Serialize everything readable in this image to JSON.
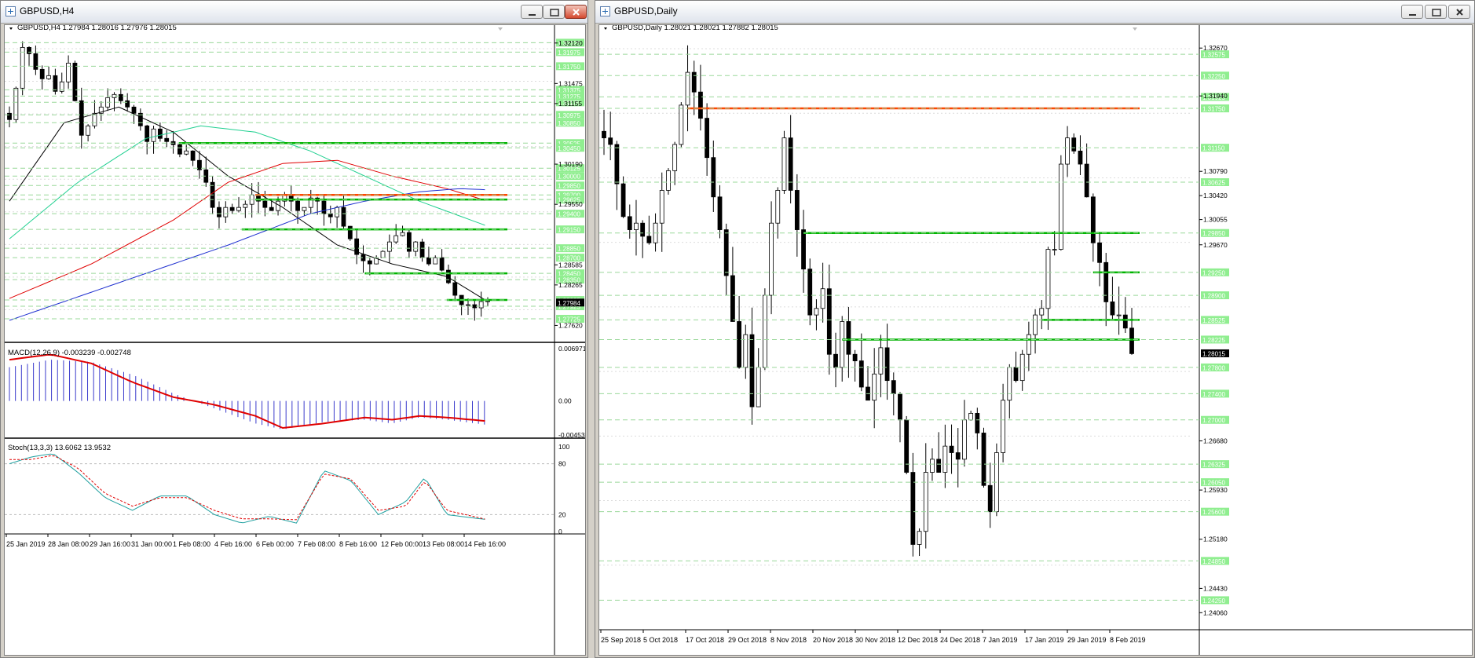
{
  "windows": {
    "left": {
      "title": "GBPUSD,H4"
    },
    "right": {
      "title": "GBPUSD,Daily"
    }
  },
  "icons": {
    "window_icon": "chart-window-icon",
    "minimize": "minimize-icon",
    "restore": "restore-icon",
    "close": "close-icon",
    "dropdown": "dropdown-triangle-icon"
  },
  "colors": {
    "bull_body": "#ffffff",
    "bear_body": "#000000",
    "grid": "#c9c9c9",
    "level_line": "#00b400",
    "resistance_line": "#ff4500",
    "ma_black": "#000000",
    "ma_aqua": "#20d090",
    "ma_red": "#e00000",
    "ma_blue": "#1e2fd0",
    "macd_hist": "#3a3acc",
    "macd_signal": "#e00000",
    "stoch_main": "#20a0a0",
    "stoch_signal": "#e00000",
    "label_bg": "#90ee90"
  },
  "chart_data": [
    {
      "type": "candlestick",
      "title": "GBPUSD,H4",
      "ohlc_header": "GBPUSD,H4  1.27984 1.28016 1.27976 1.28015",
      "ylim": [
        1.2735,
        1.3228
      ],
      "price_tick_labels": [
        "1.32120",
        "1.31475",
        "1.31155",
        "1.30190",
        "1.29550",
        "1.28585",
        "1.28265",
        "1.27620"
      ],
      "level_labels": [
        "1.32125",
        "1.31975",
        "1.31750",
        "1.31375",
        "1.31275",
        "1.31175",
        "1.30975",
        "1.30850",
        "1.30525",
        "1.30450",
        "1.30125",
        "1.30000",
        "1.29850",
        "1.29700",
        "1.29625",
        "1.29400",
        "1.29150",
        "1.28850",
        "1.28700",
        "1.28450",
        "1.28350",
        "1.28025",
        "1.27925",
        "1.27725"
      ],
      "current_price": "1.27984",
      "time_labels": [
        "25 Jan 2019",
        "28 Jan 08:00",
        "29 Jan 16:00",
        "31 Jan 00:00",
        "1 Feb 08:00",
        "4 Feb 16:00",
        "6 Feb 00:00",
        "7 Feb 08:00",
        "8 Feb 16:00",
        "12 Feb 00:00",
        "13 Feb 08:00",
        "14 Feb 16:00"
      ],
      "closes": [
        1.309,
        1.314,
        1.3205,
        1.3195,
        1.317,
        1.3155,
        1.316,
        1.3135,
        1.315,
        1.318,
        1.312,
        1.3065,
        1.308,
        1.31,
        1.311,
        1.3125,
        1.313,
        1.312,
        1.311,
        1.31,
        1.308,
        1.3055,
        1.3075,
        1.306,
        1.3055,
        1.305,
        1.3035,
        1.304,
        1.3025,
        1.301,
        1.299,
        1.295,
        1.2935,
        1.295,
        1.2945,
        1.295,
        1.2955,
        1.297,
        1.296,
        1.295,
        1.2945,
        1.296,
        1.297,
        1.296,
        1.2945,
        1.295,
        1.2965,
        1.296,
        1.294,
        1.2935,
        1.295,
        1.292,
        1.29,
        1.2875,
        1.2865,
        1.286,
        1.287,
        1.288,
        1.2895,
        1.2905,
        1.291,
        1.288,
        1.2895,
        1.287,
        1.286,
        1.287,
        1.285,
        1.283,
        1.281,
        1.2795,
        1.2795,
        1.279,
        1.28,
        1.2801
      ],
      "ma_black": [
        [
          0,
          1.296
        ],
        [
          20,
          1.3085
        ],
        [
          40,
          1.311
        ],
        [
          60,
          1.307
        ],
        [
          80,
          1.3
        ],
        [
          100,
          1.295
        ],
        [
          120,
          1.289
        ],
        [
          140,
          1.286
        ],
        [
          160,
          1.284
        ],
        [
          175,
          1.28
        ]
      ],
      "ma_aqua": [
        [
          0,
          1.29
        ],
        [
          25,
          1.299
        ],
        [
          50,
          1.306
        ],
        [
          70,
          1.308
        ],
        [
          90,
          1.307
        ],
        [
          110,
          1.304
        ],
        [
          130,
          1.3
        ],
        [
          150,
          1.296
        ],
        [
          175,
          1.292
        ]
      ],
      "ma_red": [
        [
          0,
          1.2805
        ],
        [
          30,
          1.286
        ],
        [
          60,
          1.293
        ],
        [
          80,
          1.299
        ],
        [
          100,
          1.302
        ],
        [
          120,
          1.3025
        ],
        [
          140,
          1.3
        ],
        [
          160,
          1.298
        ],
        [
          175,
          1.296
        ]
      ],
      "ma_blue": [
        [
          0,
          1.277
        ],
        [
          40,
          1.283
        ],
        [
          80,
          1.289
        ],
        [
          110,
          1.294
        ],
        [
          130,
          1.296
        ],
        [
          150,
          1.2975
        ],
        [
          165,
          1.298
        ],
        [
          175,
          1.2978
        ]
      ],
      "levels": [
        {
          "price": 1.30525,
          "x0": 62,
          "x1": 175,
          "color": "green"
        },
        {
          "price": 1.297,
          "x0": 90,
          "x1": 175,
          "color": "orange"
        },
        {
          "price": 1.29625,
          "x0": 90,
          "x1": 175,
          "color": "green"
        },
        {
          "price": 1.2915,
          "x0": 85,
          "x1": 175,
          "color": "green"
        },
        {
          "price": 1.2845,
          "x0": 130,
          "x1": 175,
          "color": "green"
        },
        {
          "price": 1.28025,
          "x0": 160,
          "x1": 175,
          "color": "green"
        }
      ]
    },
    {
      "type": "line",
      "title": "MACD(12,26,9) -0.003239 -0.002748",
      "ylim": [
        -0.004538,
        0.006971
      ],
      "tick_labels": [
        "0.006971",
        "0.00",
        "-0.004538"
      ],
      "histogram_points": [
        [
          0,
          0.0045
        ],
        [
          15,
          0.0055
        ],
        [
          30,
          0.0052
        ],
        [
          45,
          0.0035
        ],
        [
          60,
          0.001
        ],
        [
          75,
          -0.001
        ],
        [
          90,
          -0.003
        ],
        [
          100,
          -0.0038
        ],
        [
          115,
          -0.0028
        ],
        [
          130,
          -0.0025
        ],
        [
          140,
          -0.003
        ],
        [
          150,
          -0.0022
        ],
        [
          160,
          -0.0025
        ],
        [
          175,
          -0.0032
        ]
      ],
      "signal_points": [
        [
          0,
          0.0055
        ],
        [
          15,
          0.0062
        ],
        [
          30,
          0.005
        ],
        [
          45,
          0.0025
        ],
        [
          60,
          0.0005
        ],
        [
          75,
          -0.0005
        ],
        [
          90,
          -0.002
        ],
        [
          100,
          -0.0036
        ],
        [
          115,
          -0.003
        ],
        [
          130,
          -0.0022
        ],
        [
          140,
          -0.0025
        ],
        [
          150,
          -0.002
        ],
        [
          160,
          -0.0022
        ],
        [
          175,
          -0.0027
        ]
      ]
    },
    {
      "type": "line",
      "title": "Stoch(13,3,3) 13.6062 13.9532",
      "ylim": [
        0,
        100
      ],
      "tick_labels": [
        "100",
        "80",
        "20",
        "0"
      ],
      "main_points": [
        [
          0,
          80
        ],
        [
          8,
          88
        ],
        [
          16,
          92
        ],
        [
          25,
          70
        ],
        [
          35,
          40
        ],
        [
          45,
          25
        ],
        [
          55,
          42
        ],
        [
          65,
          42
        ],
        [
          75,
          20
        ],
        [
          85,
          10
        ],
        [
          95,
          18
        ],
        [
          105,
          10
        ],
        [
          115,
          72
        ],
        [
          125,
          60
        ],
        [
          135,
          20
        ],
        [
          145,
          35
        ],
        [
          152,
          64
        ],
        [
          160,
          20
        ],
        [
          175,
          14
        ]
      ],
      "signal_points": [
        [
          0,
          85
        ],
        [
          8,
          85
        ],
        [
          16,
          90
        ],
        [
          25,
          75
        ],
        [
          35,
          45
        ],
        [
          45,
          30
        ],
        [
          55,
          40
        ],
        [
          65,
          40
        ],
        [
          75,
          25
        ],
        [
          85,
          15
        ],
        [
          95,
          15
        ],
        [
          105,
          14
        ],
        [
          115,
          68
        ],
        [
          125,
          62
        ],
        [
          135,
          25
        ],
        [
          145,
          30
        ],
        [
          152,
          60
        ],
        [
          160,
          25
        ],
        [
          175,
          14
        ]
      ]
    },
    {
      "type": "candlestick",
      "title": "GBPUSD,Daily",
      "ohlc_header": "GBPUSD,Daily  1.28021 1.28021 1.27882 1.28015",
      "ylim": [
        1.238,
        1.329
      ],
      "price_tick_labels": [
        "1.32670",
        "1.31940",
        "1.30790",
        "1.30420",
        "1.30055",
        "1.29670",
        "1.26680",
        "1.25930",
        "1.25180",
        "1.24430",
        "1.24060"
      ],
      "level_labels": [
        "1.32575",
        "1.32250",
        "1.31925",
        "1.31750",
        "1.31150",
        "1.30625",
        "1.29850",
        "1.29250",
        "1.28900",
        "1.28525",
        "1.28225",
        "1.27800",
        "1.27400",
        "1.27000",
        "1.26325",
        "1.26050",
        "1.25600",
        "1.24850",
        "1.24250"
      ],
      "current_price": "1.28015",
      "time_labels": [
        "25 Sep 2018",
        "5 Oct 2018",
        "17 Oct 2018",
        "29 Oct 2018",
        "8 Nov 2018",
        "20 Nov 2018",
        "30 Nov 2018",
        "12 Dec 2018",
        "24 Dec 2018",
        "7 Jan 2019",
        "17 Jan 2019",
        "29 Jan 2019",
        "8 Feb 2019"
      ],
      "closes": [
        1.313,
        1.312,
        1.306,
        1.301,
        1.299,
        1.3,
        1.298,
        1.297,
        1.3,
        1.305,
        1.308,
        1.312,
        1.318,
        1.323,
        1.32,
        1.316,
        1.31,
        1.304,
        1.299,
        1.292,
        1.285,
        1.278,
        1.283,
        1.272,
        1.278,
        1.289,
        1.3,
        1.305,
        1.313,
        1.305,
        1.299,
        1.293,
        1.286,
        1.287,
        1.29,
        1.28,
        1.278,
        1.285,
        1.28,
        1.279,
        1.275,
        1.273,
        1.277,
        1.281,
        1.276,
        1.274,
        1.27,
        1.262,
        1.251,
        1.253,
        1.262,
        1.264,
        1.262,
        1.266,
        1.265,
        1.264,
        1.27,
        1.271,
        1.268,
        1.26,
        1.256,
        1.265,
        1.273,
        1.278,
        1.276,
        1.28,
        1.283,
        1.286,
        1.287,
        1.296,
        1.296,
        1.309,
        1.313,
        1.311,
        1.309,
        1.304,
        1.297,
        1.294,
        1.288,
        1.286,
        1.286,
        1.284,
        1.2801
      ],
      "resistance": {
        "price": 1.3175,
        "x0": 13,
        "x1": 82
      },
      "levels": [
        {
          "price": 1.2985,
          "x0": 31,
          "x1": 82
        },
        {
          "price": 1.2925,
          "x0": 76,
          "x1": 82
        },
        {
          "price": 1.28525,
          "x0": 68,
          "x1": 82
        },
        {
          "price": 1.28225,
          "x0": 37,
          "x1": 82
        }
      ]
    }
  ]
}
